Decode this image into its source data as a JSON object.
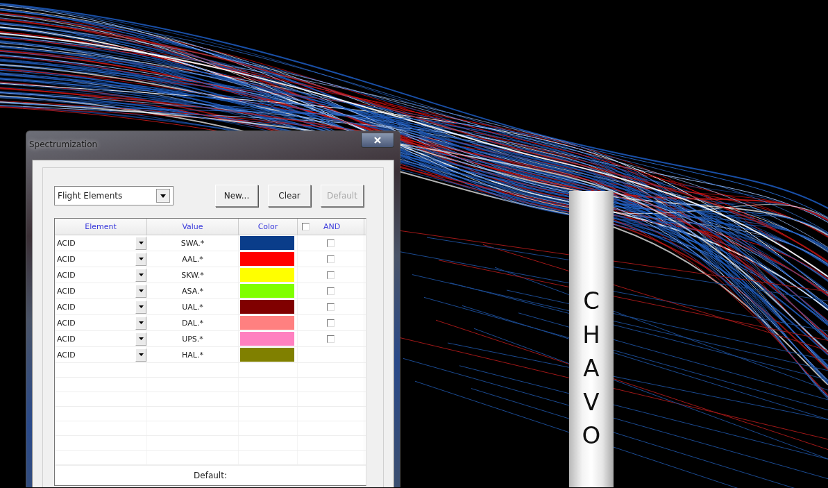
{
  "map": {
    "fix_label": "CHAVO"
  },
  "dialog": {
    "title": "Spectrumization",
    "category_dropdown": {
      "value": "Flight Elements"
    },
    "buttons": [
      {
        "label": "New...",
        "disabled": false
      },
      {
        "label": "Clear",
        "disabled": false
      },
      {
        "label": "Default",
        "disabled": true
      }
    ],
    "table": {
      "columns": [
        "Element",
        "Value",
        "Color",
        "AND"
      ],
      "header_checkbox": {
        "checked": false
      },
      "rows": [
        {
          "element": "ACID",
          "value": "SWA.*",
          "color": "#0a3d8a",
          "kind": "checkbox",
          "checked": false
        },
        {
          "element": "ACID",
          "value": "AAL.*",
          "color": "#ff0000",
          "kind": "checkbox",
          "checked": false
        },
        {
          "element": "ACID",
          "value": "SKW.*",
          "color": "#ffff00",
          "kind": "checkbox",
          "checked": false
        },
        {
          "element": "ACID",
          "value": "ASA.*",
          "color": "#80ff00",
          "kind": "checkbox",
          "checked": false
        },
        {
          "element": "ACID",
          "value": "UAL.*",
          "color": "#800000",
          "kind": "checkbox",
          "checked": false
        },
        {
          "element": "ACID",
          "value": "DAL.*",
          "color": "#ff8080",
          "kind": "checkbox",
          "checked": false
        },
        {
          "element": "ACID",
          "value": "UPS.*",
          "color": "#ff80c0",
          "kind": "checkbox",
          "checked": false
        },
        {
          "element": "ACID",
          "value": "HAL.*",
          "color": "#808000",
          "kind": "plain"
        }
      ],
      "footer": "Default:"
    }
  }
}
